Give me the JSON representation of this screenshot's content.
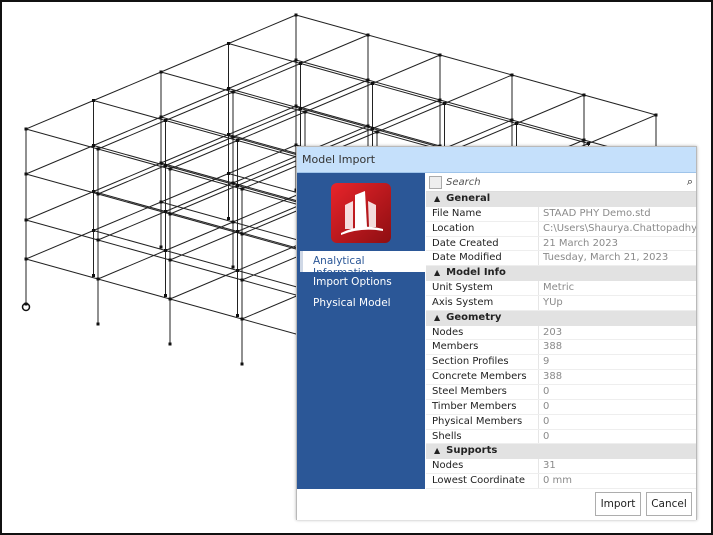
{
  "dialog": {
    "title": "Model Import",
    "sidebar": {
      "items": [
        {
          "label": "Analytical Information",
          "selected": true
        },
        {
          "label": "Import Options"
        },
        {
          "label": "Physical Model"
        }
      ]
    },
    "search": {
      "placeholder": "Search"
    },
    "sections": [
      {
        "title": "General",
        "rows": [
          [
            "File Name",
            "STAAD PHY Demo.std"
          ],
          [
            "Location",
            "C:\\Users\\Shaurya.Chattopadhya\\D"
          ],
          [
            "Date Created",
            "21 March 2023"
          ],
          [
            "Date Modified",
            "Tuesday, March 21, 2023"
          ]
        ]
      },
      {
        "title": "Model Info",
        "rows": [
          [
            "Unit System",
            "Metric"
          ],
          [
            "Axis System",
            "YUp"
          ]
        ]
      },
      {
        "title": "Geometry",
        "rows": [
          [
            "Nodes",
            "203"
          ],
          [
            "Members",
            "388"
          ],
          [
            "Section Profiles",
            "9"
          ],
          [
            "Concrete Members",
            "388"
          ],
          [
            "Steel Members",
            "0"
          ],
          [
            "Timber Members",
            "0"
          ],
          [
            "Physical Members",
            "0"
          ],
          [
            "Shells",
            "0"
          ]
        ]
      },
      {
        "title": "Supports",
        "rows": [
          [
            "Nodes",
            "31"
          ],
          [
            "Lowest Coordinate",
            "0 mm"
          ]
        ]
      }
    ],
    "buttons": {
      "import": "Import",
      "cancel": "Cancel"
    }
  },
  "colors": {
    "sidebar": "#2b5797",
    "titlebar": "#c5e0fb",
    "logo": "#d11a20"
  }
}
